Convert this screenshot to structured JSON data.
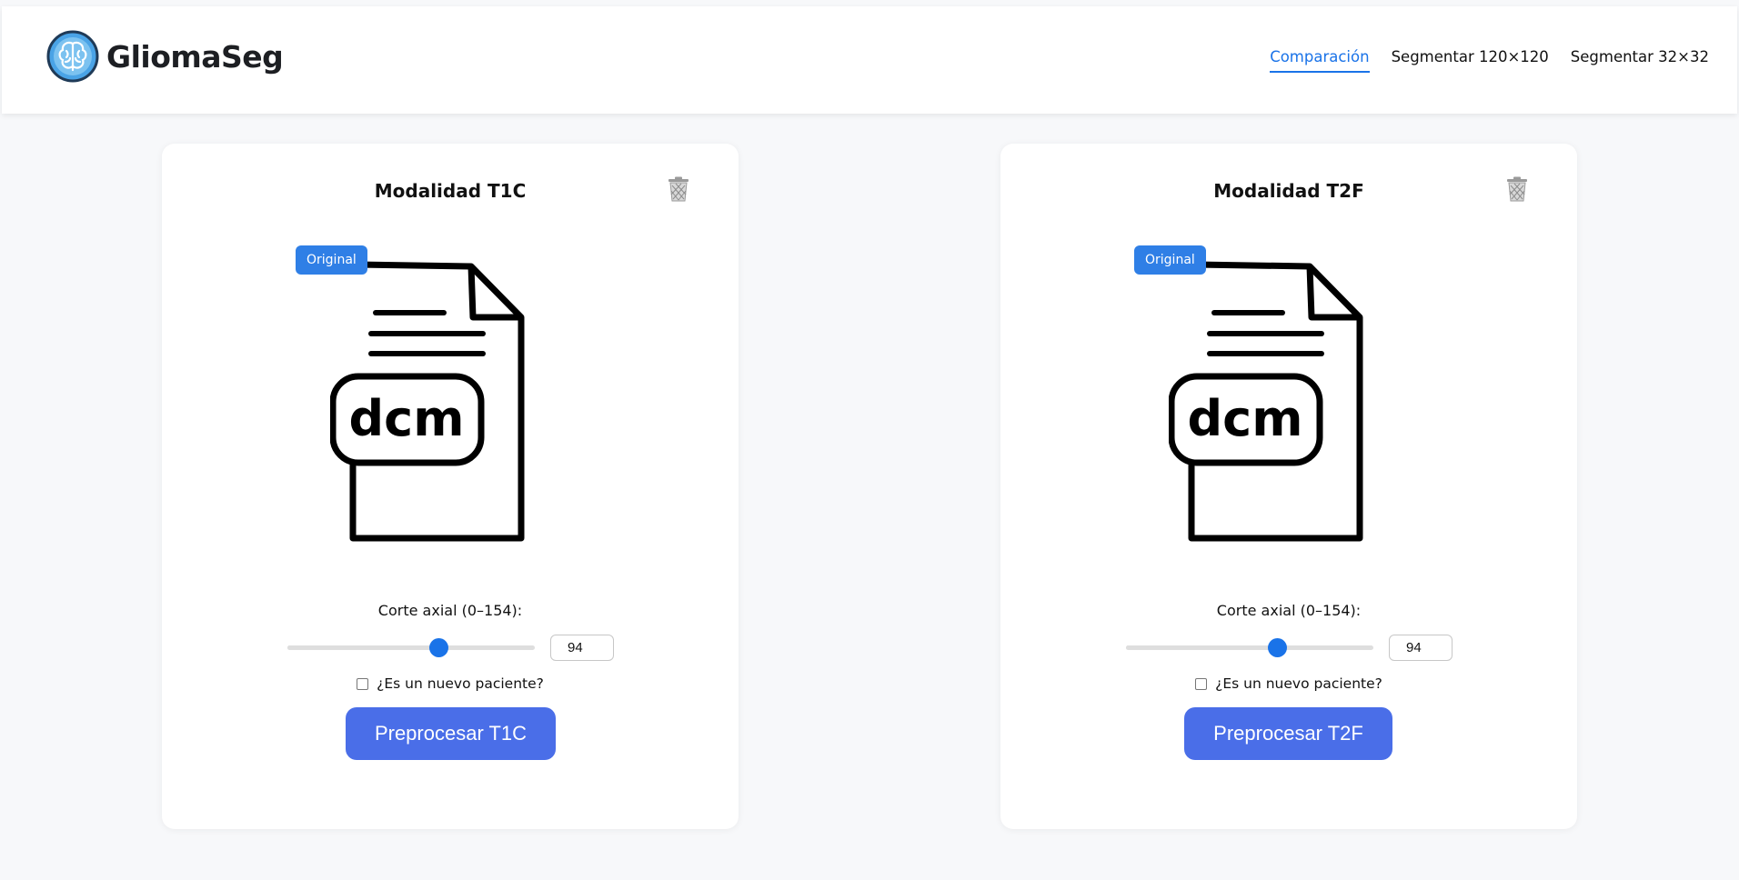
{
  "app": {
    "brand": "GliomaSeg",
    "brand_icon": "brain-icon",
    "accent_color": "#1a73e8",
    "button_color": "#4a6ee8"
  },
  "nav": {
    "items": [
      {
        "label": "Comparación",
        "active": true
      },
      {
        "label": "Segmentar 120×120",
        "active": false
      },
      {
        "label": "Segmentar 32×32",
        "active": false
      }
    ]
  },
  "cards": [
    {
      "title": "Modalidad T1C",
      "badge": "Original",
      "file_type": "dcm",
      "slider_label": "Corte axial (0–154):",
      "slice_value": "94",
      "slice_min": 0,
      "slice_max": 154,
      "checkbox_label": "¿Es un nuevo paciente?",
      "checkbox_checked": false,
      "button_label": "Preprocesar T1C",
      "delete_icon": "trash-icon"
    },
    {
      "title": "Modalidad T2F",
      "badge": "Original",
      "file_type": "dcm",
      "slider_label": "Corte axial (0–154):",
      "slice_value": "94",
      "slice_min": 0,
      "slice_max": 154,
      "checkbox_label": "¿Es un nuevo paciente?",
      "checkbox_checked": false,
      "button_label": "Preprocesar T2F",
      "delete_icon": "trash-icon"
    }
  ]
}
